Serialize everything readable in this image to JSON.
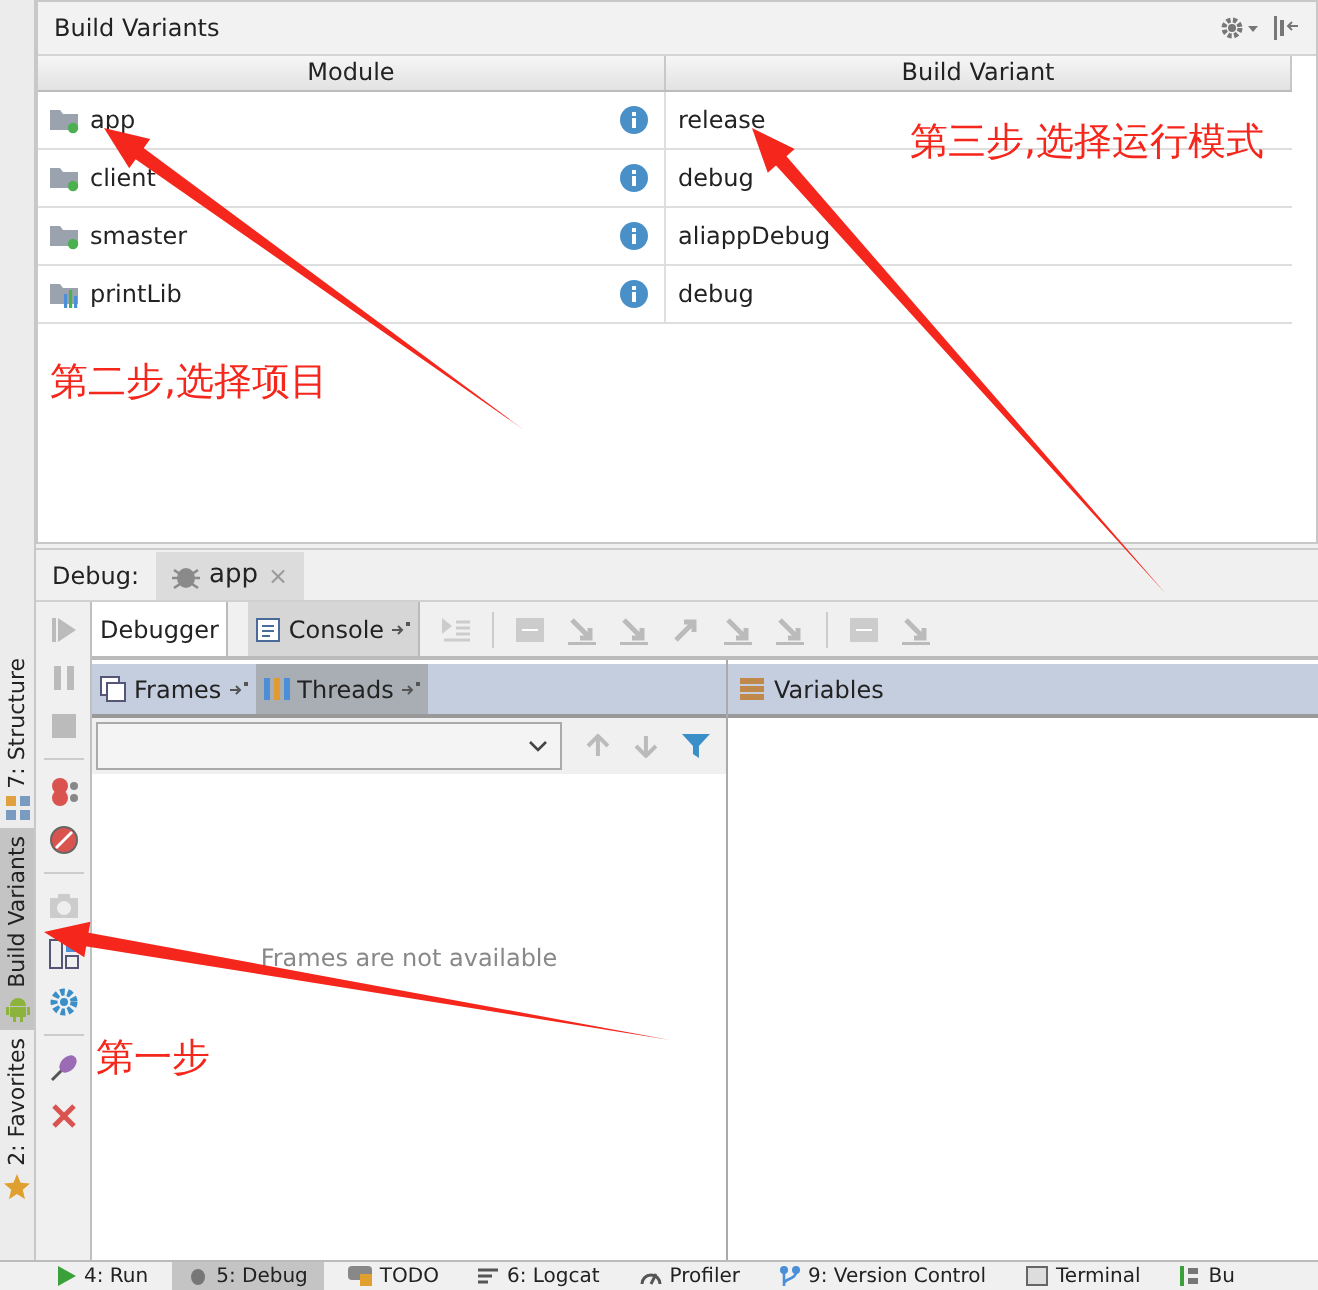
{
  "left_tool_tabs": [
    {
      "label": "7: Structure",
      "kind": "structure",
      "selected": false
    },
    {
      "label": "Build Variants",
      "kind": "android",
      "selected": true
    },
    {
      "label": "2: Favorites",
      "kind": "star",
      "selected": false
    }
  ],
  "build_variants": {
    "title": "Build Variants",
    "columns": [
      "Module",
      "Build Variant"
    ],
    "rows": [
      {
        "module": "app",
        "kind": "app",
        "variant": "release"
      },
      {
        "module": "client",
        "kind": "app",
        "variant": "debug"
      },
      {
        "module": "smaster",
        "kind": "app",
        "variant": "aliappDebug"
      },
      {
        "module": "printLib",
        "kind": "library",
        "variant": "debug"
      }
    ]
  },
  "debug": {
    "label": "Debug:",
    "session": "app",
    "session_close": "×",
    "tabs": [
      {
        "label": "Debugger",
        "selected": true
      },
      {
        "label": "Console",
        "selected": false
      }
    ],
    "frame_tabs": [
      {
        "label": "Frames",
        "selected": true
      },
      {
        "label": "Threads",
        "selected": false
      }
    ],
    "frames_empty": "Frames are not available",
    "variables_title": "Variables"
  },
  "bottom_tabs": [
    {
      "label": "4: Run",
      "kind": "run",
      "selected": false
    },
    {
      "label": "5: Debug",
      "kind": "debug",
      "selected": true
    },
    {
      "label": "TODO",
      "kind": "todo",
      "selected": false
    },
    {
      "label": "6: Logcat",
      "kind": "logcat",
      "selected": false
    },
    {
      "label": "Profiler",
      "kind": "profiler",
      "selected": false
    },
    {
      "label": "9: Version Control",
      "kind": "vcs",
      "selected": false
    },
    {
      "label": "Terminal",
      "kind": "terminal",
      "selected": false
    },
    {
      "label": "Bu",
      "kind": "build",
      "selected": false
    }
  ],
  "annotations": [
    {
      "text": "第二步,选择项目"
    },
    {
      "text": "第三步,选择运行模式"
    },
    {
      "text": "第一步"
    }
  ]
}
